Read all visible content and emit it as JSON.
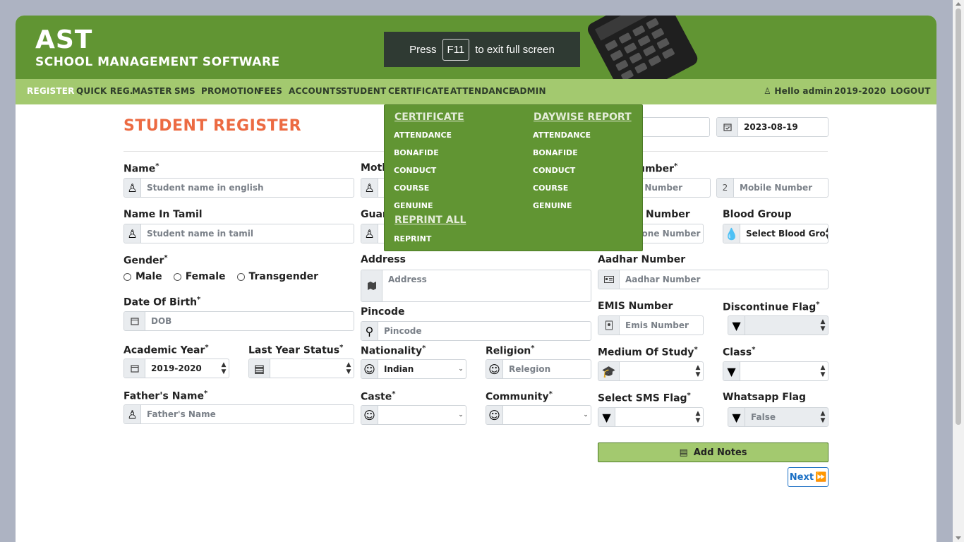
{
  "brand": {
    "title": "AST",
    "subtitle": "SCHOOL MANAGEMENT SOFTWARE"
  },
  "fullscreen_toast": {
    "prefix": "Press",
    "key": "F11",
    "suffix": "to exit full screen"
  },
  "nav": {
    "items": [
      "REGISTER",
      "QUICK REG.",
      "MASTER",
      "SMS",
      "PROMOTION",
      "FEES",
      "ACCOUNTS",
      "STUDENT",
      "CERTIFICATE",
      "ATTENDANCE",
      "ADMIN"
    ],
    "active": "REGISTER",
    "user": "Hello admin",
    "year": "2019-2020",
    "logout": "LOGOUT"
  },
  "certificate_menu": {
    "col1_head": "CERTIFICATE",
    "col1_items": [
      "ATTENDANCE",
      "BONAFIDE",
      "CONDUCT",
      "COURSE",
      "GENUINE"
    ],
    "col1_head2": "REPRINT ALL",
    "col1_items2": [
      "REPRINT"
    ],
    "col2_head": "DAYWISE REPORT",
    "col2_items": [
      "ATTENDANCE",
      "BONAFIDE",
      "CONDUCT",
      "COURSE",
      "GENUINE"
    ]
  },
  "page": {
    "title": "STUDENT REGISTER",
    "date": "2023-08-19"
  },
  "form": {
    "name": {
      "label": "Name",
      "placeholder": "Student name in english"
    },
    "name_tamil": {
      "label": "Name In Tamil",
      "placeholder": "Student name in tamil"
    },
    "mother_label": "Moth",
    "guardian_label": "Guar",
    "gender": {
      "label": "Gender",
      "options": [
        "Male",
        "Female",
        "Transgender"
      ]
    },
    "dob": {
      "label": "Date Of Birth",
      "placeholder": "DOB"
    },
    "academic_year": {
      "label": "Academic Year",
      "value": "2019-2020"
    },
    "last_year_status": {
      "label": "Last Year Status",
      "value": ""
    },
    "father": {
      "label": "Father's Name",
      "placeholder": "Father's Name"
    },
    "address": {
      "label": "Address",
      "placeholder": "Address"
    },
    "pincode": {
      "label": "Pincode",
      "placeholder": "Pincode"
    },
    "nationality": {
      "label": "Nationality",
      "value": "Indian"
    },
    "religion": {
      "label": "Religion",
      "placeholder": "Relegion"
    },
    "caste": {
      "label": "Caste",
      "value": ""
    },
    "community": {
      "label": "Community",
      "value": ""
    },
    "mobile": {
      "label": "umber",
      "placeholder1": "e Number",
      "prefix2": "2",
      "placeholder2": "Mobile Number"
    },
    "phone": {
      "label": "Number",
      "placeholder": "hone Number"
    },
    "blood_group": {
      "label": "Blood Group",
      "placeholder": "Select Blood Gro"
    },
    "aadhar": {
      "label": "Aadhar Number",
      "placeholder": "Aadhar Number"
    },
    "emis": {
      "label": "EMIS Number",
      "placeholder": "Emis Number"
    },
    "discontinue": {
      "label": "Discontinue Flag",
      "value": ""
    },
    "medium": {
      "label": "Medium Of Study",
      "value": ""
    },
    "class": {
      "label": "Class",
      "value": ""
    },
    "sms_flag": {
      "label": "Select SMS Flag",
      "value": ""
    },
    "whatsapp": {
      "label": "Whatsapp Flag",
      "value": "False"
    }
  },
  "buttons": {
    "add_notes": "Add Notes",
    "next": "Next"
  },
  "colors": {
    "header": "#619533",
    "nav": "#a3c96f",
    "title": "#ec6a42",
    "accent_blue": "#1a6fc4"
  }
}
